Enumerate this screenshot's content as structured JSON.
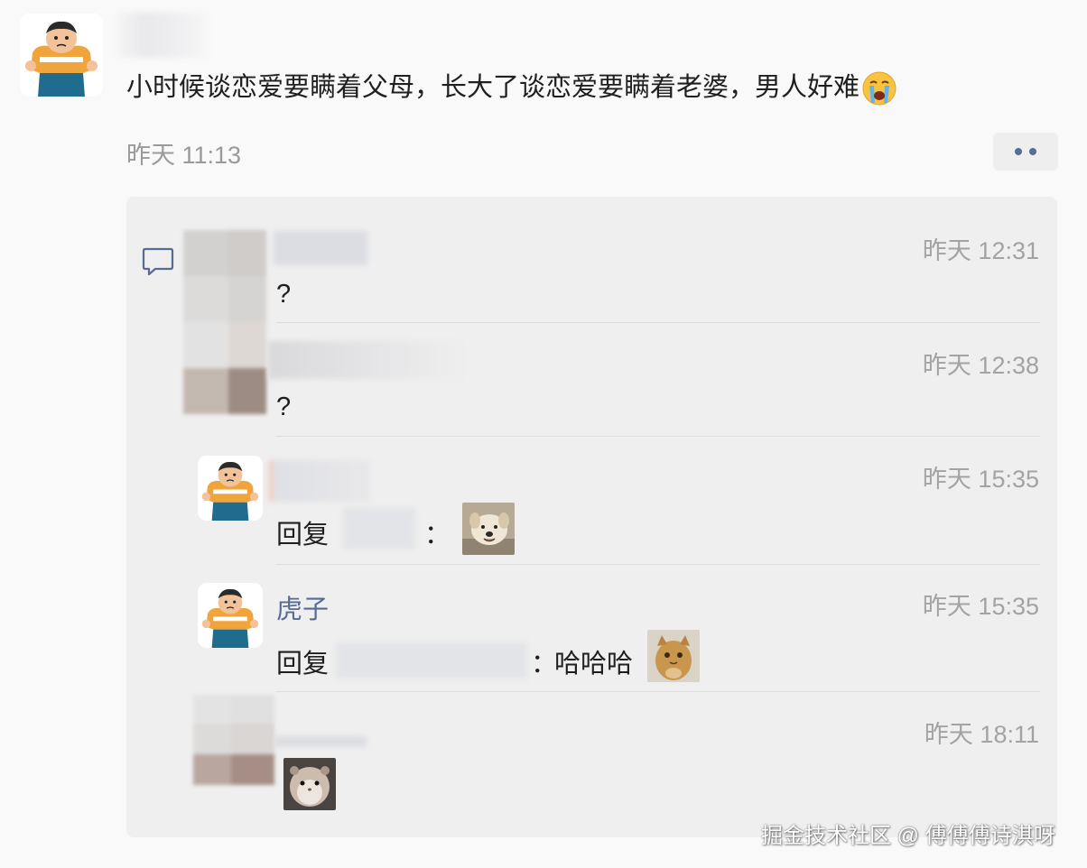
{
  "post": {
    "text": "小时候谈恋爱要瞒着父母，长大了谈恋爱要瞒着老婆，男人好难",
    "emoji": "crying-face-emoji",
    "time": "昨天 11:13"
  },
  "comments": [
    {
      "time": "昨天 12:31",
      "text": "?"
    },
    {
      "time": "昨天 12:38",
      "text": "?"
    },
    {
      "time": "昨天 15:35",
      "reply_prefix": "回复",
      "separator": "：",
      "sticker": "dog-sticker"
    },
    {
      "time": "昨天 15:35",
      "name": "虎子",
      "reply_prefix": "回复",
      "separator": "：",
      "text": "哈哈哈",
      "sticker": "cat-sticker"
    },
    {
      "time": "昨天 18:11",
      "sticker": "hamster-sticker"
    }
  ],
  "watermark": "掘金技术社区 @ 傅傅傅诗淇呀",
  "colors": {
    "link": "#576b95",
    "panel": "#efefef",
    "time": "#9a9a9a"
  }
}
